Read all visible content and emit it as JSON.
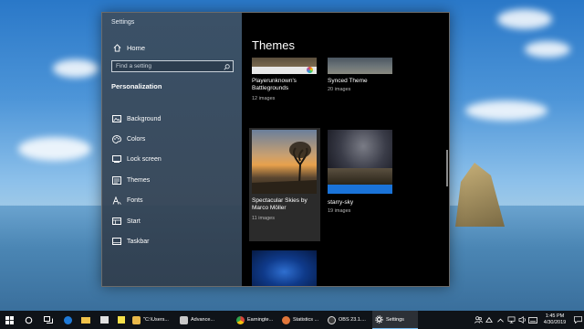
{
  "window": {
    "title": "Settings"
  },
  "sidebar": {
    "home_label": "Home",
    "search_placeholder": "Find a setting",
    "section_title": "Personalization",
    "items": [
      {
        "label": "Background",
        "icon": "image-icon"
      },
      {
        "label": "Colors",
        "icon": "palette-icon"
      },
      {
        "label": "Lock screen",
        "icon": "lock-screen-icon"
      },
      {
        "label": "Themes",
        "icon": "brush-icon"
      },
      {
        "label": "Fonts",
        "icon": "font-icon"
      },
      {
        "label": "Start",
        "icon": "start-icon"
      },
      {
        "label": "Taskbar",
        "icon": "taskbar-icon"
      }
    ]
  },
  "content": {
    "title": "Themes",
    "themes": [
      {
        "name": "Playerunknown's Battlegrounds",
        "count": "12 images"
      },
      {
        "name": "Synced Theme",
        "count": "20 images"
      },
      {
        "name": "Spectacular Skies by Marco Möller",
        "count": "11 images"
      },
      {
        "name": "starry-sky",
        "count": "19 images"
      }
    ]
  },
  "taskbar": {
    "apps": [
      {
        "label": "\"C:\\Users...",
        "color": "#e8b84a"
      },
      {
        "label": "Advance...",
        "color": "#c8c8c8"
      },
      {
        "label": "Earningte...",
        "color": "#d9453a"
      },
      {
        "label": "Statistics ...",
        "color": "#e0763a"
      },
      {
        "label": "OBS 23.1....",
        "color": "#3a3a3a"
      },
      {
        "label": "Settings",
        "color": "#7a7a7a"
      }
    ],
    "time": "1:45 PM",
    "date": "4/30/2019"
  },
  "colors": {
    "accent": "#76b9ed",
    "window_sidebar": "#3c4e60",
    "content_bg": "#000000"
  }
}
